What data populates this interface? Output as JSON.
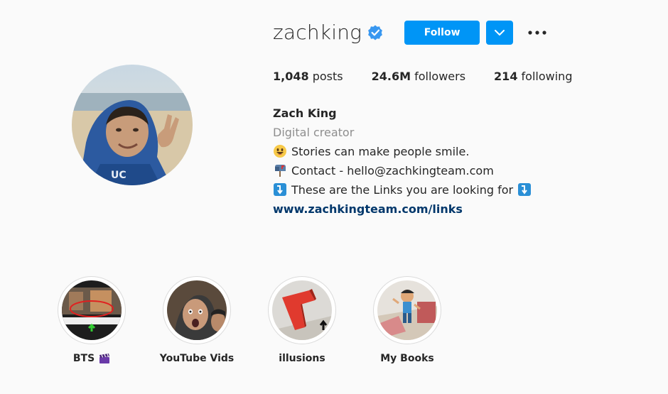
{
  "profile": {
    "username": "zachking",
    "follow_label": "Follow",
    "stats": {
      "posts_count": "1,048",
      "posts_label": "posts",
      "followers_count": "24.6M",
      "followers_label": "followers",
      "following_count": "214",
      "following_label": "following"
    },
    "bio": {
      "name": "Zach King",
      "category": "Digital creator",
      "line1": "Stories can make people smile.",
      "line2": "Contact - hello@zachkingteam.com",
      "line3": "These are the Links you are looking for",
      "link": "www.zachkingteam.com/links"
    }
  },
  "highlights": [
    {
      "label": "BTS",
      "icon": "clapper-board-icon"
    },
    {
      "label": "YouTube Vids"
    },
    {
      "label": "illusions"
    },
    {
      "label": "My Books"
    }
  ],
  "colors": {
    "accent": "#0095f6",
    "link": "#00376b",
    "muted": "#8e8e8e",
    "text": "#262626",
    "background": "#fafafa"
  }
}
